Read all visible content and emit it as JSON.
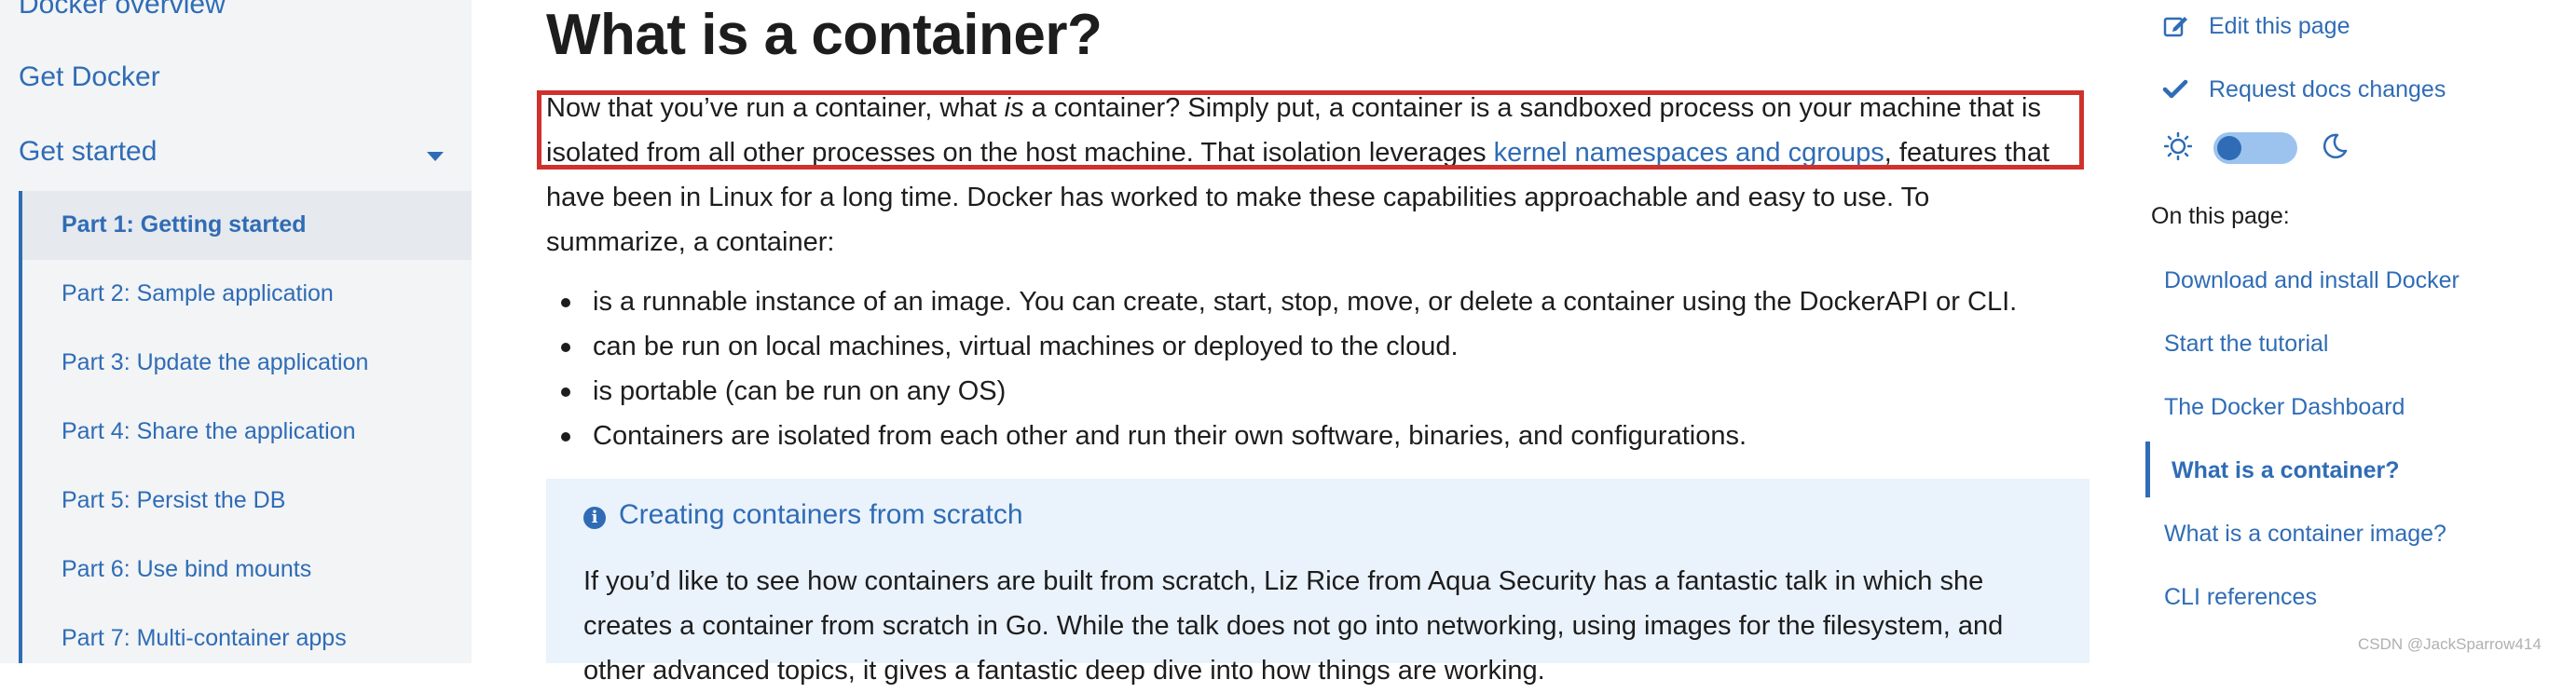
{
  "sidebar": {
    "top_items": [
      {
        "label": "Docker overview"
      },
      {
        "label": "Get Docker"
      },
      {
        "label": "Get started"
      }
    ],
    "sub_items": [
      {
        "label": "Part 1: Getting started",
        "active": true
      },
      {
        "label": "Part 2: Sample application"
      },
      {
        "label": "Part 3: Update the application"
      },
      {
        "label": "Part 4: Share the application"
      },
      {
        "label": "Part 5: Persist the DB"
      },
      {
        "label": "Part 6: Use bind mounts"
      },
      {
        "label": "Part 7: Multi-container apps"
      }
    ]
  },
  "main": {
    "title": "What is a container?",
    "intro": {
      "t1": "Now that you’ve run a container, what ",
      "t2_italic": "is",
      "t3": " a container? Simply put, a container is a sandboxed process on your machine that is isolated from all other processes on the host machine. That isolation leverages ",
      "link": "kernel namespaces and cgroups",
      "t4": ", features that have been in Linux for a long time. Docker has worked to make these capabilities approachable and easy to use. To summarize, a container:"
    },
    "bullets": [
      "is a runnable instance of an image. You can create, start, stop, move, or delete a container using the DockerAPI or CLI.",
      "can be run on local machines, virtual machines or deployed to the cloud.",
      "is portable (can be run on any OS)",
      "Containers are isolated from each other and run their own software, binaries, and configurations."
    ],
    "callout": {
      "icon": "i",
      "title": "Creating containers from scratch",
      "text": "If you’d like to see how containers are built from scratch, Liz Rice from Aqua Security has a fantastic talk in which she creates a container from scratch in Go. While the talk does not go into networking, using images for the filesystem, and other advanced topics, it gives a fantastic deep dive into how things are working."
    }
  },
  "right": {
    "edit_label": "Edit this page",
    "request_label": "Request docs changes",
    "on_this_page": "On this page:",
    "toc": [
      {
        "label": "Download and install Docker"
      },
      {
        "label": "Start the tutorial"
      },
      {
        "label": "The Docker Dashboard"
      },
      {
        "label": "What is a container?",
        "active": true
      },
      {
        "label": "What is a container image?"
      },
      {
        "label": "CLI references"
      }
    ]
  },
  "watermark": "CSDN @JackSparrow414",
  "colors": {
    "accent": "#2f6cb5",
    "highlight_border": "#d0312d",
    "callout_bg": "#eaf2fb",
    "sidebar_bg": "#f2f4f6"
  }
}
